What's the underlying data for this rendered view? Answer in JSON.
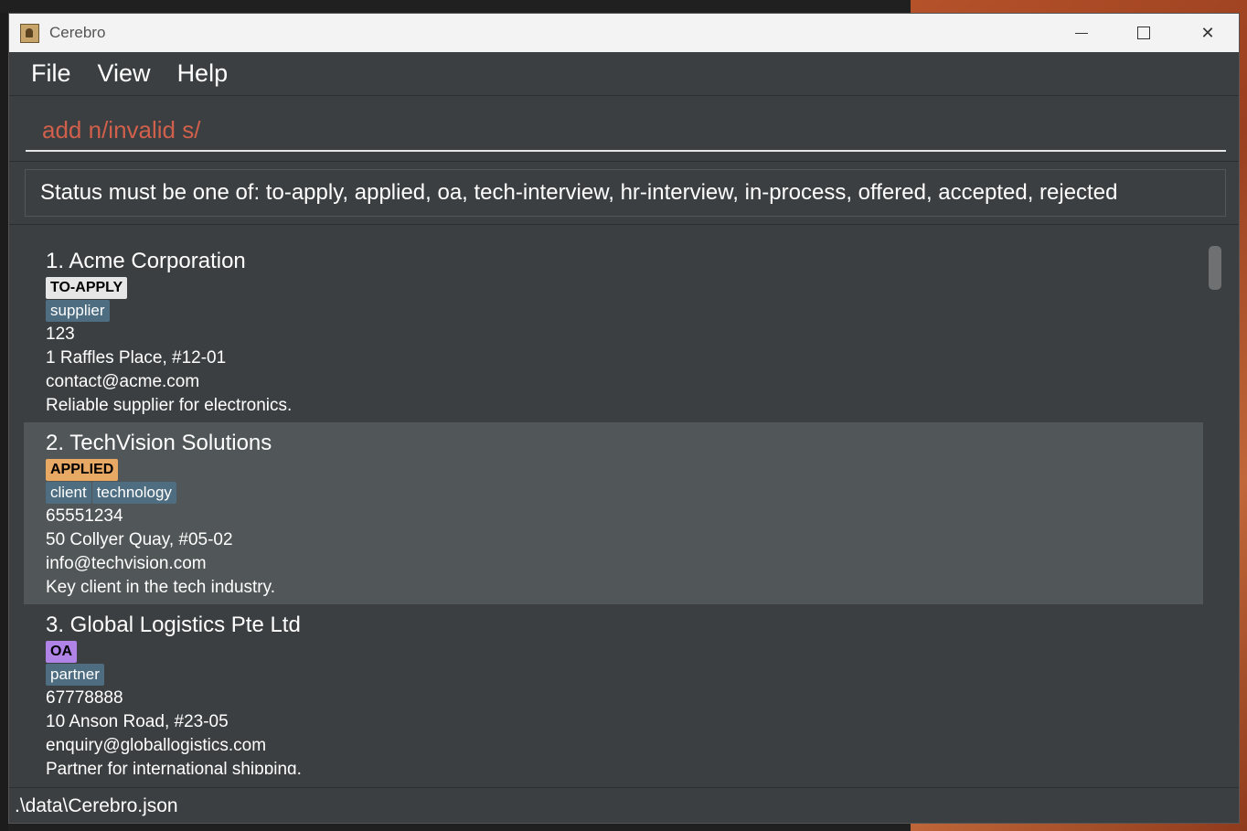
{
  "window": {
    "title": "Cerebro"
  },
  "menu": {
    "items": [
      "File",
      "View",
      "Help"
    ]
  },
  "command": {
    "text": "add n/invalid s/",
    "color": "#d0604b"
  },
  "result": {
    "message": "Status must be one of: to-apply, applied, oa, tech-interview, hr-interview, in-process, offered, accepted, rejected"
  },
  "companies": [
    {
      "name": "1. Acme Corporation",
      "status": "TO-APPLY",
      "status_color": "#e6e6e6",
      "tags": [
        "supplier"
      ],
      "phone": "123",
      "address": "1 Raffles Place, #12-01",
      "email": "contact@acme.com",
      "remark": "Reliable supplier for electronics."
    },
    {
      "name": "2. TechVision Solutions",
      "status": "APPLIED",
      "status_color": "#e8a964",
      "tags": [
        "client",
        "technology"
      ],
      "phone": "65551234",
      "address": "50 Collyer Quay, #05-02",
      "email": "info@techvision.com",
      "remark": "Key client in the tech industry."
    },
    {
      "name": "3. Global Logistics Pte Ltd",
      "status": "OA",
      "status_color": "#b083e6",
      "tags": [
        "partner"
      ],
      "phone": "67778888",
      "address": "10 Anson Road, #23-05",
      "email": "enquiry@globallogistics.com",
      "remark": "Partner for international shipping."
    }
  ],
  "statusbar": {
    "path": ".\\data\\Cerebro.json"
  },
  "colors": {
    "tag": "#4e6d80",
    "card_alt": "#515658",
    "window_bg": "#3c3f41"
  }
}
